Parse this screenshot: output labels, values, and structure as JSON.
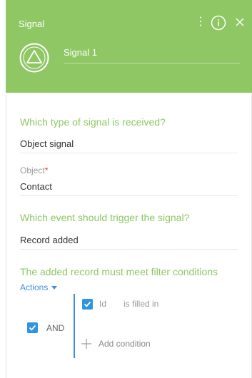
{
  "header": {
    "title": "Signal",
    "signal_name": "Signal 1",
    "accent_color": "#8ec764"
  },
  "icons": {
    "menu": "vertical-dots-icon",
    "info": "info-icon",
    "close": "close-icon",
    "signal": "triangle-signal-icon"
  },
  "form": {
    "signal_type_question": "Which type of signal is received?",
    "signal_type_value": "Object signal",
    "object_label": "Object",
    "object_required_mark": "*",
    "object_value": "Contact",
    "event_question": "Which event should trigger the signal?",
    "event_value": "Record added",
    "filter_title": "The added record must meet filter conditions",
    "actions_label": "Actions"
  },
  "filter": {
    "group_operator": "AND",
    "group_checked": true,
    "conditions": [
      {
        "field": "Id",
        "operator": "is filled in",
        "checked": true
      }
    ],
    "add_condition_label": "Add condition"
  }
}
